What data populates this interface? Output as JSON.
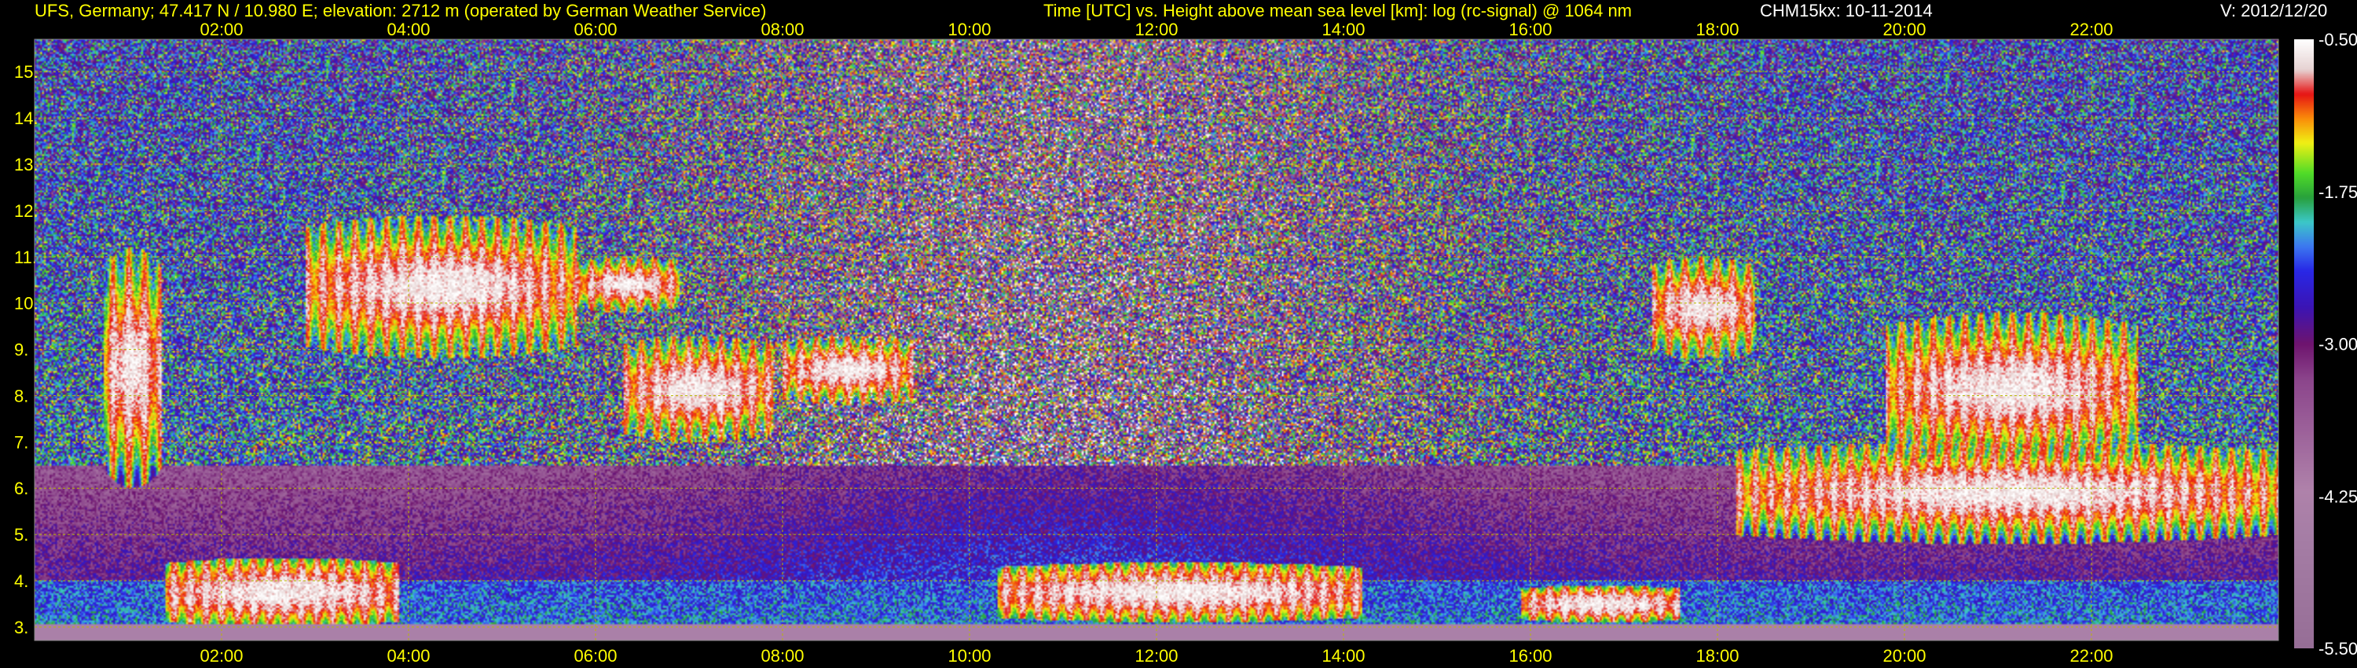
{
  "header": {
    "station": "UFS, Germany; 47.417 N / 10.980 E; elevation: 2712 m  (operated by German Weather Service)",
    "axes": "Time [UTC] vs. Height above mean sea level [km]: log (rc-signal) @ 1064 nm",
    "instrument": "CHM15kx: 10-11-2014",
    "version": "V: 2012/12/20"
  },
  "colors": {
    "header_text": "#ffff00",
    "station_text": "#ffff00",
    "version_text": "#ffffff",
    "tick_text": "#ffff00",
    "grid": "#b8b800",
    "background": "#000000"
  },
  "chart_data": {
    "type": "heatmap",
    "x": {
      "label": "Time [UTC]",
      "ticks": [
        "02:00",
        "04:00",
        "06:00",
        "08:00",
        "10:00",
        "12:00",
        "14:00",
        "16:00",
        "18:00",
        "20:00",
        "22:00"
      ],
      "tick_hours": [
        2,
        4,
        6,
        8,
        10,
        12,
        14,
        16,
        18,
        20,
        22
      ],
      "range_hours": [
        0,
        24
      ]
    },
    "y": {
      "label": "Height above mean sea level [km]",
      "ticks": [
        "3.",
        "4.",
        "5.",
        "6.",
        "7.",
        "8.",
        "9.",
        "10.",
        "11.",
        "12.",
        "13.",
        "14.",
        "15."
      ],
      "tick_values": [
        3,
        4,
        5,
        6,
        7,
        8,
        9,
        10,
        11,
        12,
        13,
        14,
        15
      ],
      "range_km": [
        2.71,
        15.7
      ]
    },
    "colorbar": {
      "label": "log (rc-signal)",
      "ticks": [
        "-0.50",
        "-1.75",
        "-3.00",
        "-4.25",
        "-5.50"
      ],
      "tick_values": [
        -0.5,
        -1.75,
        -3.0,
        -4.25,
        -5.5
      ],
      "range": [
        -5.5,
        -0.5
      ]
    },
    "grid": true,
    "features": [
      {
        "kind": "cirrus",
        "t0": 0.75,
        "t1": 1.35,
        "h0": 6.0,
        "h1": 11.2
      },
      {
        "kind": "cirrus",
        "t0": 2.9,
        "t1": 5.8,
        "h0": 8.8,
        "h1": 11.9
      },
      {
        "kind": "cirrus",
        "t0": 5.8,
        "t1": 6.9,
        "h0": 9.8,
        "h1": 11.0
      },
      {
        "kind": "cirrus",
        "t0": 6.3,
        "t1": 7.9,
        "h0": 7.0,
        "h1": 9.3
      },
      {
        "kind": "cirrus",
        "t0": 8.0,
        "t1": 9.4,
        "h0": 7.8,
        "h1": 9.3
      },
      {
        "kind": "cirrus",
        "t0": 17.3,
        "t1": 18.4,
        "h0": 8.8,
        "h1": 11.0
      },
      {
        "kind": "mid_cloud",
        "t0": 18.2,
        "t1": 24.0,
        "h0": 4.8,
        "h1": 7.0
      },
      {
        "kind": "mid_cloud",
        "t0": 19.8,
        "t1": 22.5,
        "h0": 6.5,
        "h1": 9.8
      },
      {
        "kind": "low_layer",
        "t0": 10.3,
        "t1": 14.2,
        "h0": 3.1,
        "h1": 4.4
      },
      {
        "kind": "low_layer",
        "t0": 15.9,
        "t1": 17.6,
        "h0": 3.1,
        "h1": 3.9
      },
      {
        "kind": "low_layer",
        "t0": 1.4,
        "t1": 3.9,
        "h0": 3.0,
        "h1": 4.5
      }
    ]
  }
}
